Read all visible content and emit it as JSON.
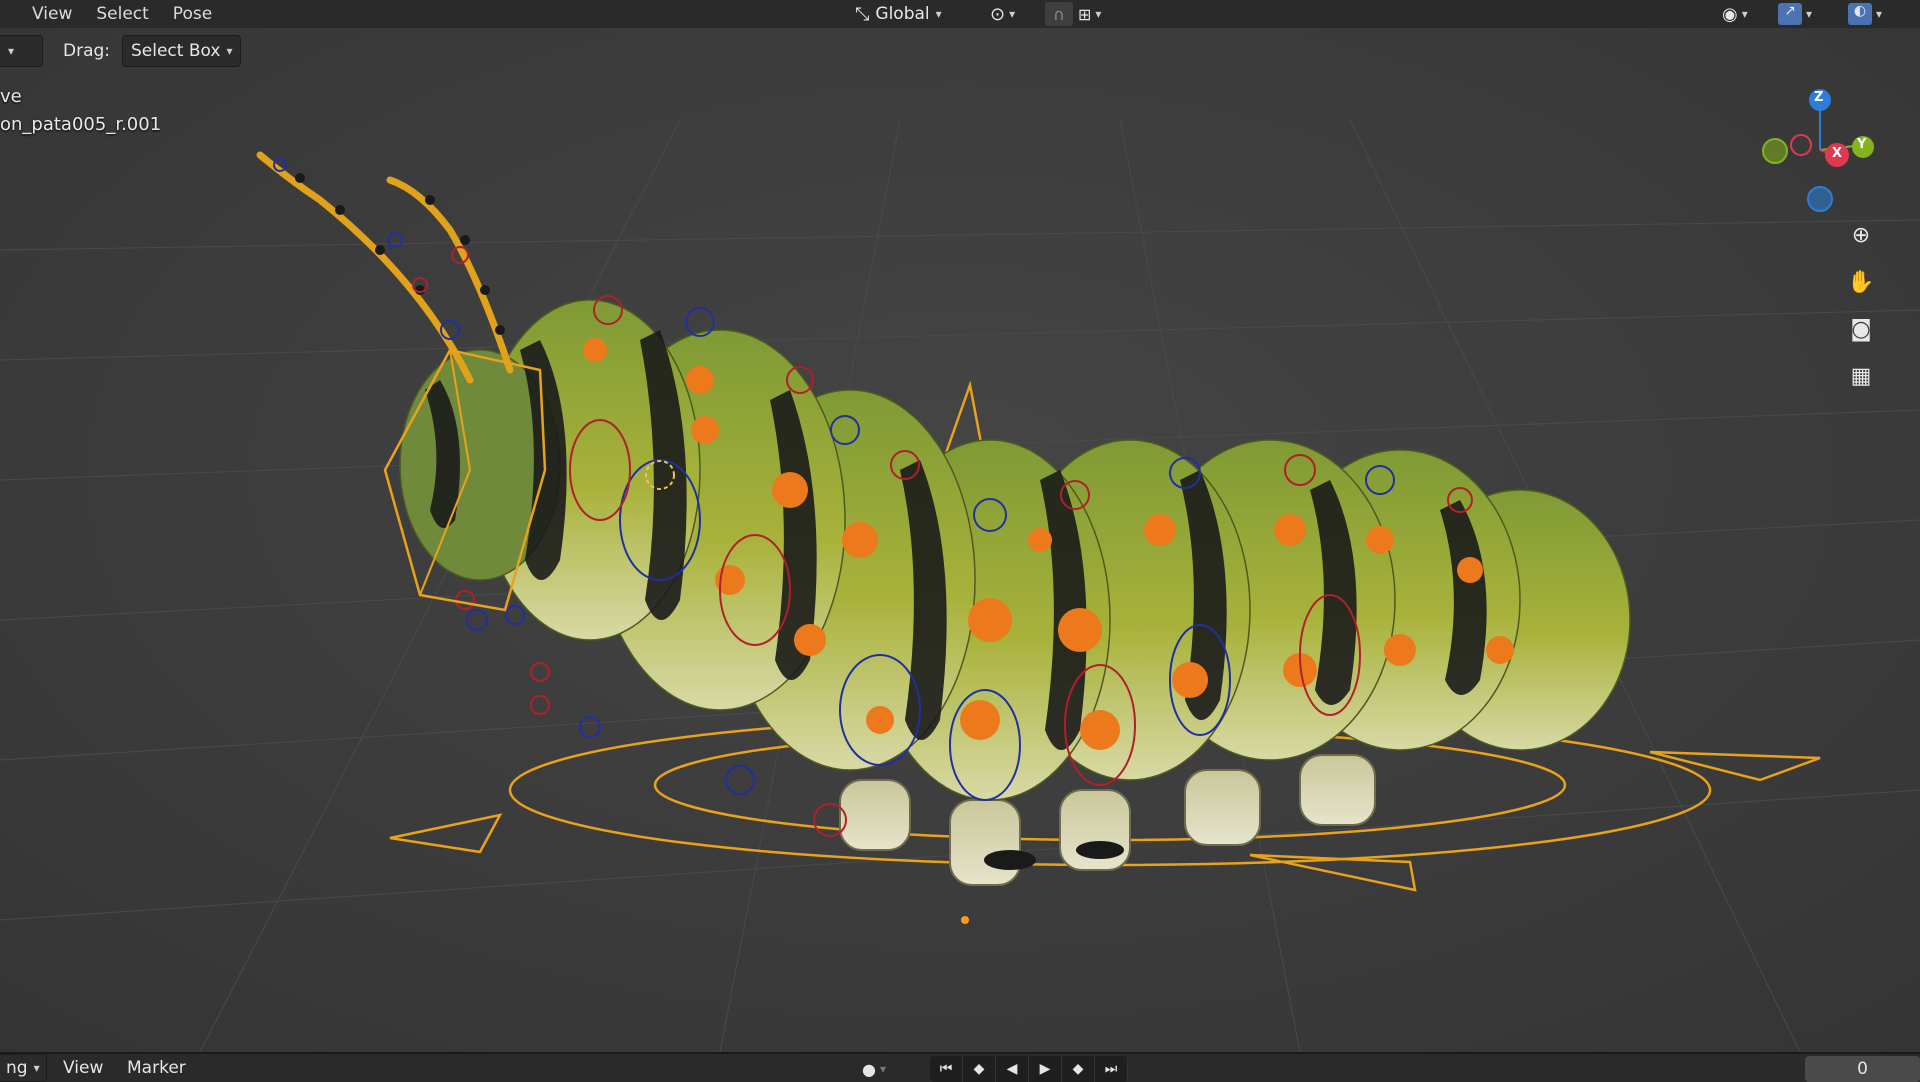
{
  "header": {
    "menus": [
      "View",
      "Select",
      "Pose"
    ],
    "orientation_label": "Global",
    "drag_label": "Drag:",
    "drag_value": "Select Box"
  },
  "overlay": {
    "line1": "ve",
    "line2": "on_pata005_r.001"
  },
  "gizmo": {
    "x": "X",
    "y": "Y",
    "z": "Z"
  },
  "timeline": {
    "left_dropdown": "ng",
    "menus": [
      "View",
      "Marker"
    ],
    "frame": "0"
  },
  "colors": {
    "accent": "#e8a21c",
    "axis_x": "#e0384f",
    "axis_y": "#83b31d",
    "axis_z": "#2c7fd9"
  }
}
